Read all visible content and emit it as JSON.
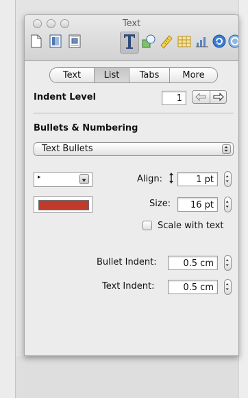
{
  "window": {
    "title": "Text"
  },
  "toolbar": {
    "icons": [
      "document-inspector-icon",
      "layout-inspector-icon",
      "wrap-inspector-icon",
      "text-inspector-icon",
      "graphic-inspector-icon",
      "metrics-inspector-icon",
      "table-inspector-icon",
      "chart-inspector-icon",
      "link-inspector-icon",
      "quicktime-inspector-icon"
    ],
    "active": "text-inspector-icon"
  },
  "tabs": [
    {
      "label": "Text",
      "selected": false
    },
    {
      "label": "List",
      "selected": true
    },
    {
      "label": "Tabs",
      "selected": false
    },
    {
      "label": "More",
      "selected": false
    }
  ],
  "indent": {
    "label": "Indent Level",
    "value": "1"
  },
  "bullets": {
    "heading": "Bullets & Numbering",
    "style_value": "Text Bullets",
    "bullet_char": "▸",
    "color": "#c0392b",
    "align_label": "Align:",
    "align_value": "1 pt",
    "size_label": "Size:",
    "size_value": "16 pt",
    "scale_label": "Scale with text",
    "scale_checked": false
  },
  "indents": {
    "bullet_label": "Bullet Indent:",
    "bullet_value": "0.5 cm",
    "text_label": "Text Indent:",
    "text_value": "0.5 cm"
  }
}
